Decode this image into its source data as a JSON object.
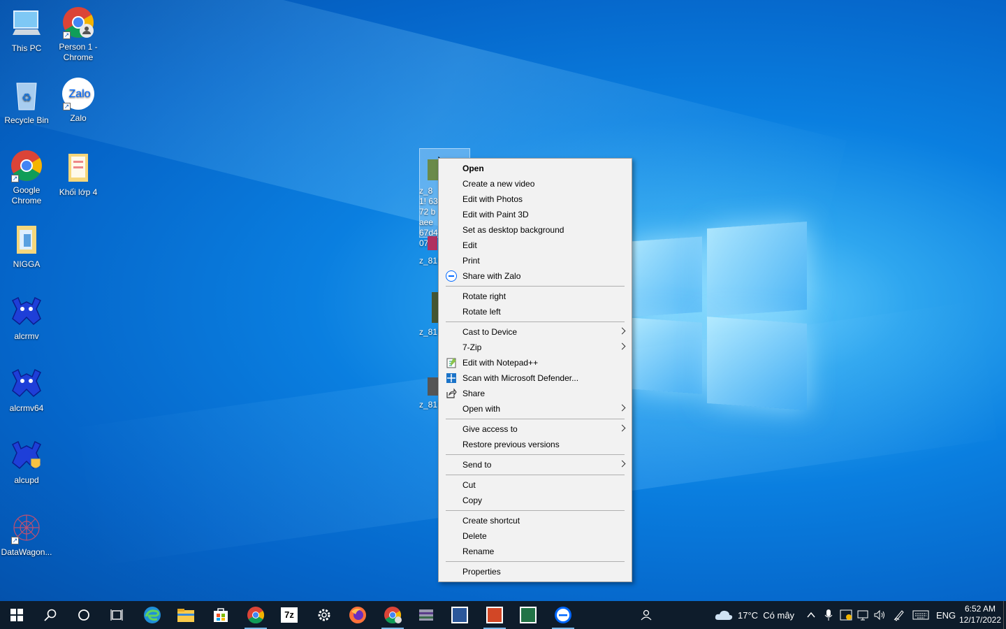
{
  "desktop": {
    "icons": [
      {
        "label": "This PC",
        "icon": "this-pc-icon"
      },
      {
        "label": "Person 1 - Chrome",
        "icon": "chrome-profile-icon"
      },
      {
        "label": "Recycle Bin",
        "icon": "recycle-bin-icon"
      },
      {
        "label": "Zalo",
        "icon": "zalo-icon"
      },
      {
        "label": "Google Chrome",
        "icon": "chrome-icon"
      },
      {
        "label": "Khối lớp 4",
        "icon": "folder-icon"
      },
      {
        "label": "NIGGA",
        "icon": "folder-icon"
      },
      {
        "label": "alcrmv",
        "icon": "realtek-icon"
      },
      {
        "label": "alcrmv64",
        "icon": "realtek-icon"
      },
      {
        "label": "alcupd",
        "icon": "realtek-shield-icon"
      },
      {
        "label": "DataWagon...",
        "icon": "datawagon-icon"
      }
    ],
    "files": [
      {
        "label": "z_81! 6372 baee 67d4 07a"
      },
      {
        "label": "z_81!"
      },
      {
        "label": "z_81!"
      },
      {
        "label": "z_81!"
      }
    ]
  },
  "context_menu": {
    "items": [
      {
        "label": "Open"
      },
      {
        "label": "Create a new video"
      },
      {
        "label": "Edit with Photos"
      },
      {
        "label": "Edit with Paint 3D"
      },
      {
        "label": "Set as desktop background"
      },
      {
        "label": "Edit"
      },
      {
        "label": "Print"
      },
      {
        "label": "Share with Zalo"
      },
      {
        "label": "Rotate right"
      },
      {
        "label": "Rotate left"
      },
      {
        "label": "Cast to Device"
      },
      {
        "label": "7-Zip"
      },
      {
        "label": "Edit with Notepad++"
      },
      {
        "label": "Scan with Microsoft Defender..."
      },
      {
        "label": "Share"
      },
      {
        "label": "Open with"
      },
      {
        "label": "Give access to"
      },
      {
        "label": "Restore previous versions"
      },
      {
        "label": "Send to"
      },
      {
        "label": "Cut"
      },
      {
        "label": "Copy"
      },
      {
        "label": "Create shortcut"
      },
      {
        "label": "Delete"
      },
      {
        "label": "Rename"
      },
      {
        "label": "Properties"
      }
    ]
  },
  "taskbar": {
    "weather": "17°C  Có mây",
    "language": "ENG",
    "time": "6:52 AM",
    "date": "12/17/2022",
    "zalo_label": "Zalo",
    "apps": [
      "start-icon",
      "search-icon",
      "cortana-icon",
      "task-view-icon",
      "edge-icon",
      "file-explorer-icon",
      "store-icon",
      "chrome-icon",
      "7zip-icon",
      "settings-icon",
      "firefox-icon",
      "chrome-profile-icon",
      "winrar-icon",
      "word-icon",
      "powerpoint-icon",
      "excel-icon",
      "zalo-icon"
    ]
  },
  "seven_zip_label": "7z",
  "colors": {
    "accent": "#0078d7",
    "taskbar": "#0e1c2b",
    "menu_bg": "#f2f2f2"
  }
}
